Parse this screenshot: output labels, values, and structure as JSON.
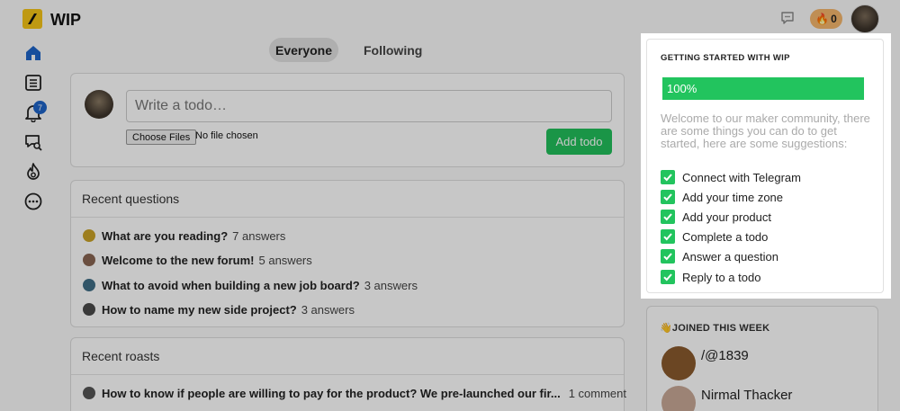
{
  "app": {
    "logo_text": "WIP"
  },
  "header": {
    "streak_count": "0"
  },
  "tabs": [
    {
      "label": "Everyone"
    },
    {
      "label": "Following"
    }
  ],
  "nav": {
    "notifications_badge": "7"
  },
  "composer": {
    "placeholder": "Write a todo…",
    "file_button": "Choose Files",
    "file_status": "No file chosen",
    "submit_label": "Add todo"
  },
  "questions": {
    "heading": "Recent questions",
    "items": [
      {
        "title": "What are you reading?",
        "meta": "7 answers"
      },
      {
        "title": "Welcome to the new forum!",
        "meta": "5 answers"
      },
      {
        "title": "What to avoid when building a new job board?",
        "meta": "3 answers"
      },
      {
        "title": "How to name my new side project?",
        "meta": "3 answers"
      }
    ]
  },
  "roasts": {
    "heading": "Recent roasts",
    "items": [
      {
        "title": "How to know if people are willing to pay for the product? We pre-launched our fir...",
        "meta": "1 comment"
      }
    ]
  },
  "joined": {
    "heading": "👋JOINED THIS WEEK",
    "users": [
      {
        "name": "/@1839"
      },
      {
        "name": "Nirmal Thacker"
      }
    ]
  },
  "getting_started": {
    "title": "GETTING STARTED WITH WIP",
    "progress_label": "100%",
    "progress_value": 1.0,
    "description": "Welcome to our maker community, there are some things you can do to get started, here are some suggestions:",
    "steps": [
      {
        "label": "Connect with Telegram",
        "done": true
      },
      {
        "label": "Add your time zone",
        "done": true
      },
      {
        "label": "Add your product",
        "done": true
      },
      {
        "label": "Complete a todo",
        "done": true
      },
      {
        "label": "Answer a question",
        "done": true
      },
      {
        "label": "Reply to a todo",
        "done": true
      }
    ]
  },
  "colors": {
    "accent_green": "#22c45e",
    "badge_blue": "#1e64c8",
    "logo_yellow": "#f5c518"
  },
  "icons": {
    "nav": [
      "home-icon",
      "list-icon",
      "bell-icon",
      "chat-search-icon",
      "fire-icon",
      "more-icon"
    ],
    "header": [
      "chat-icon",
      "fire-icon",
      "avatar"
    ]
  }
}
